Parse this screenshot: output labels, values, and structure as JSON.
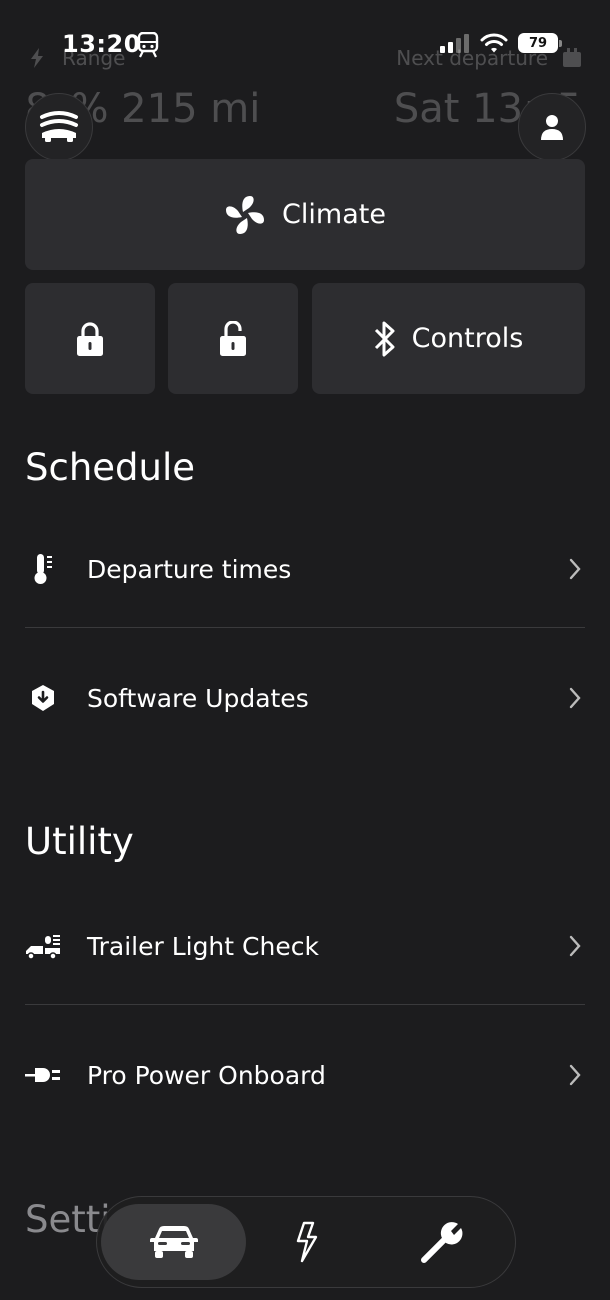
{
  "status_bar": {
    "time": "13:20",
    "battery": "79"
  },
  "header": {
    "range_label": "Range",
    "range_value": "8_% 215 mi",
    "departure_label": "Next departure",
    "departure_value": "Sat 13:_5"
  },
  "quick_actions": {
    "climate_label": "Climate",
    "controls_label": "Controls"
  },
  "schedule": {
    "title": "Schedule",
    "items": [
      {
        "label": "Departure times",
        "icon": "thermometer-icon"
      },
      {
        "label": "Software Updates",
        "icon": "download-shield-icon"
      }
    ]
  },
  "utility": {
    "title": "Utility",
    "items": [
      {
        "label": "Trailer Light Check",
        "icon": "trailer-light-icon"
      },
      {
        "label": "Pro Power Onboard",
        "icon": "power-plug-icon"
      }
    ]
  },
  "settings": {
    "title": "Setti"
  },
  "tabs": [
    {
      "icon": "car-icon",
      "selected": true
    },
    {
      "icon": "lightning-icon",
      "selected": false
    },
    {
      "icon": "wrench-icon",
      "selected": false
    }
  ]
}
